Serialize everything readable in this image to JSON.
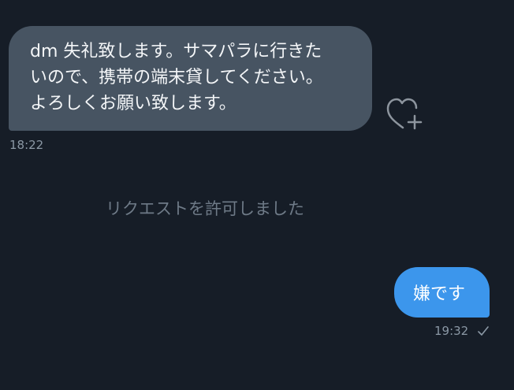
{
  "incoming": {
    "lines": [
      "dm 失礼致します。サマパラに行きた",
      "いので、携帯の端末貸してください。",
      "よろしくお願い致します。"
    ],
    "time": "18:22"
  },
  "system_message": "リクエストを許可しました",
  "outgoing": {
    "text": "嫌です",
    "time": "19:32"
  },
  "icons": {
    "react": "heart-plus-icon",
    "status": "checkmark-icon"
  },
  "colors": {
    "background": "#161d27",
    "incoming_bubble": "#475462",
    "outgoing_bubble": "#3c96ec",
    "muted_text": "#8b98a5",
    "system_text": "#6e7a87"
  }
}
